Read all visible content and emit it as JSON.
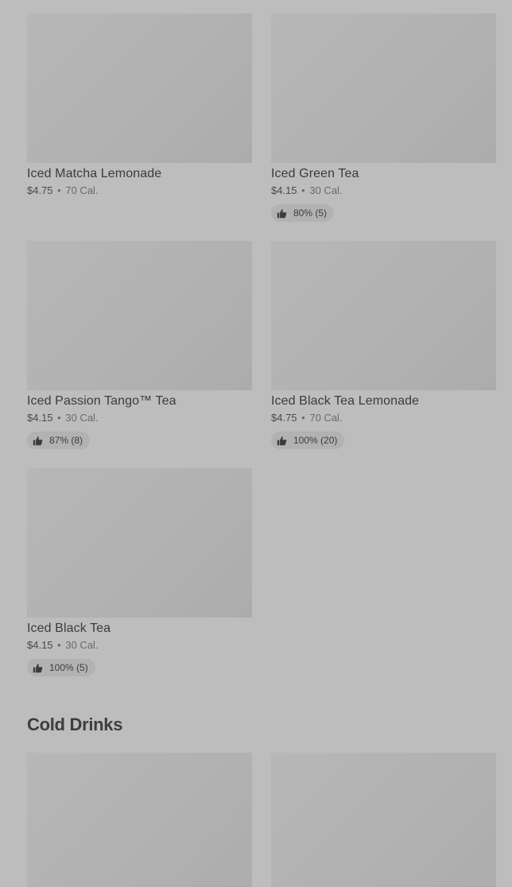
{
  "products": [
    {
      "name": "Iced Matcha Lemonade",
      "price": "$4.75",
      "calories": "70 Cal.",
      "rating": ""
    },
    {
      "name": "Iced Green Tea",
      "price": "$4.15",
      "calories": "30 Cal.",
      "rating": "80% (5)"
    },
    {
      "name": "Iced Passion Tango™ Tea",
      "price": "$4.15",
      "calories": "30 Cal.",
      "rating": "87% (8)"
    },
    {
      "name": "Iced Black Tea Lemonade",
      "price": "$4.75",
      "calories": "70 Cal.",
      "rating": "100% (20)"
    },
    {
      "name": "Iced Black Tea",
      "price": "$4.15",
      "calories": "30 Cal.",
      "rating": "100% (5)"
    }
  ],
  "separator": "•",
  "section": {
    "title": "Cold Drinks"
  },
  "icons": {
    "rating": "thumbs-up-icon"
  }
}
